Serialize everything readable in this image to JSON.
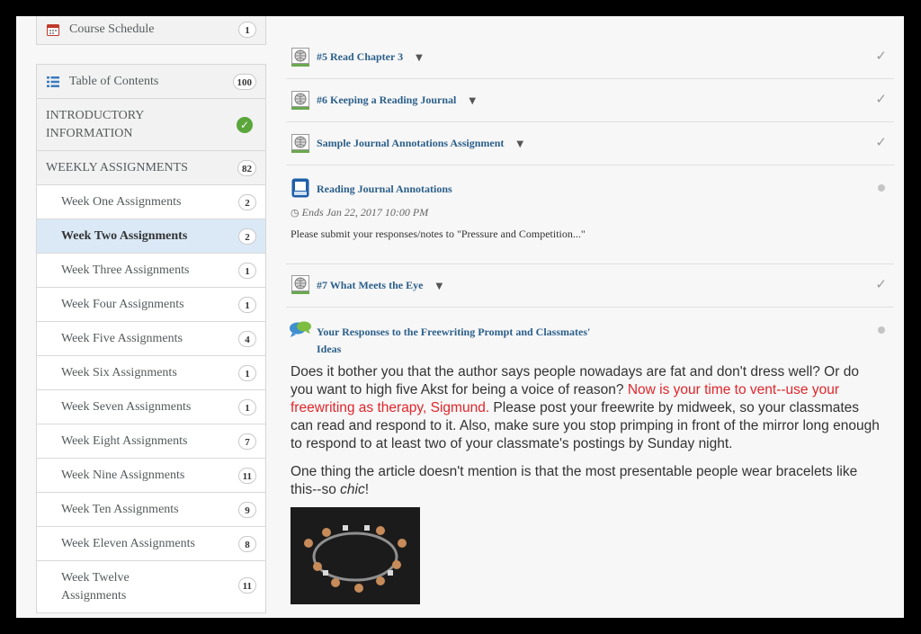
{
  "sidebar": {
    "course_schedule": {
      "label": "Course Schedule",
      "count": "1"
    },
    "toc": {
      "label": "Table of Contents",
      "count": "100"
    },
    "intro": {
      "label_line1": "INTRODUCTORY",
      "label_line2": "INFORMATION"
    },
    "weekly": {
      "label": "WEEKLY ASSIGNMENTS",
      "count": "82"
    },
    "weeks": [
      {
        "label": "Week One Assignments",
        "count": "2"
      },
      {
        "label": "Week Two Assignments",
        "count": "2"
      },
      {
        "label": "Week Three Assignments",
        "count": "1"
      },
      {
        "label": "Week Four Assignments",
        "count": "1"
      },
      {
        "label": "Week Five Assignments",
        "count": "4"
      },
      {
        "label": "Week Six Assignments",
        "count": "1"
      },
      {
        "label": "Week Seven Assignments",
        "count": "1"
      },
      {
        "label": "Week Eight Assignments",
        "count": "7"
      },
      {
        "label": "Week Nine Assignments",
        "count": "11"
      },
      {
        "label": "Week Ten Assignments",
        "count": "9"
      },
      {
        "label": "Week Eleven Assignments",
        "count": "8"
      },
      {
        "label_line1": "Week Twelve",
        "label_line2": "Assignments",
        "count": "11"
      }
    ]
  },
  "main": {
    "items": [
      {
        "title": "#5 Read Chapter 3"
      },
      {
        "title": "#6 Keeping a Reading Journal"
      },
      {
        "title": "Sample Journal Annotations Assignment"
      },
      {
        "title": "Reading Journal Annotations",
        "ends": "Ends Jan 22, 2017 10:00 PM",
        "desc": "Please submit your responses/notes to \"Pressure and Competition...\""
      },
      {
        "title": "#7 What Meets the Eye"
      },
      {
        "title_line1": "Your Responses to the Freewriting Prompt and Classmates'",
        "title_line2": "Ideas"
      }
    ],
    "para1_a": "Does it bother you that the author says people nowadays are fat and don't dress well? Or do you want to high five Akst for being a voice of reason? ",
    "para1_red": "Now is your time to vent--use your freewriting as therapy, Sigmund.",
    "para1_b": " Please post your freewrite by midweek, so your classmates can read and respond to it. Also, make sure you stop primping in front of the mirror long enough to respond to at least two of your classmate's postings by Sunday night.",
    "para2_a": "One thing the article doesn't mention is that the most presentable people wear bracelets like this--so ",
    "para2_em": "chic",
    "para2_b": "!"
  }
}
